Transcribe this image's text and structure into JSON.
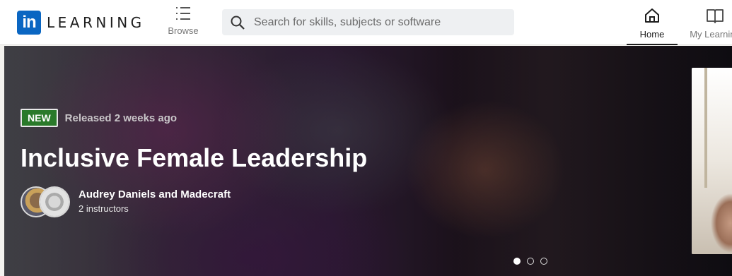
{
  "header": {
    "logo_badge": "in",
    "logo_word": "LEARNING",
    "browse_label": "Browse",
    "search_placeholder": "Search for skills, subjects or software",
    "nav": {
      "home_label": "Home",
      "my_learning_label": "My Learning"
    }
  },
  "hero": {
    "badge": "NEW",
    "released": "Released 2 weeks ago",
    "title": "Inclusive Female Leadership",
    "instructors": "Audrey Daniels and Madecraft",
    "instructor_count": "2 instructors",
    "carousel": {
      "total": 3,
      "active": 1
    }
  },
  "icons": {
    "browse": "list-icon",
    "search": "search-icon",
    "home": "home-icon",
    "my_learning": "book-icon"
  },
  "colors": {
    "brand": "#0a66c2",
    "new_badge": "#2a7a2a"
  }
}
